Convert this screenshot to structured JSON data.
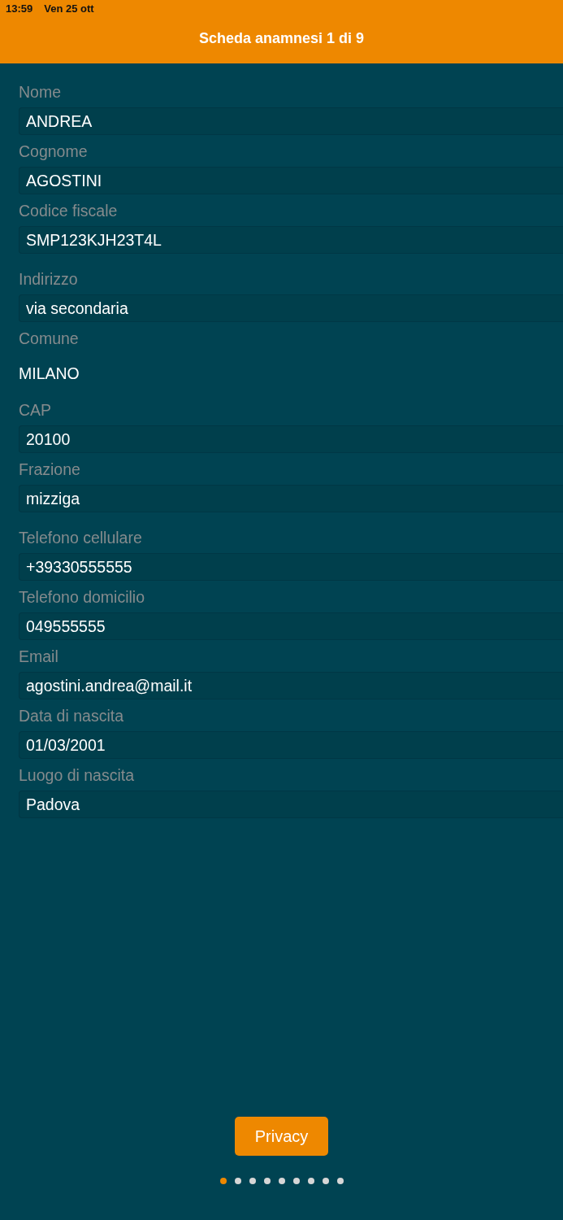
{
  "status_bar": {
    "time": "13:59",
    "date": "Ven 25 ott"
  },
  "header": {
    "title": "Scheda anamnesi 1 di 9"
  },
  "sections": [
    {
      "fields": [
        {
          "label": "Nome",
          "kind": "input",
          "value": "ANDREA"
        },
        {
          "label": "Cognome",
          "kind": "input",
          "value": "AGOSTINI"
        },
        {
          "label": "Codice fiscale",
          "kind": "input",
          "value": "SMP123KJH23T4L"
        }
      ]
    },
    {
      "fields": [
        {
          "label": "Indirizzo",
          "kind": "input",
          "value": "via secondaria"
        },
        {
          "label": "Comune",
          "kind": "text",
          "value": "MILANO"
        },
        {
          "label": "CAP",
          "kind": "input",
          "value": "20100"
        },
        {
          "label": "Frazione",
          "kind": "input",
          "value": "mizziga"
        }
      ]
    },
    {
      "fields": [
        {
          "label": "Telefono cellulare",
          "kind": "input",
          "value": "+39330555555"
        },
        {
          "label": "Telefono domicilio",
          "kind": "input",
          "value": "049555555"
        },
        {
          "label": "Email",
          "kind": "input",
          "value": "agostini.andrea@mail.it"
        },
        {
          "label": "Data di nascita",
          "kind": "input",
          "value": "01/03/2001"
        },
        {
          "label": "Luogo di nascita",
          "kind": "input",
          "value": "Padova"
        }
      ]
    }
  ],
  "privacy_button": {
    "label": "Privacy"
  },
  "pages": [
    {
      "selected": true
    },
    {
      "selected": false
    },
    {
      "selected": false
    },
    {
      "selected": false
    },
    {
      "selected": false
    },
    {
      "selected": false
    },
    {
      "selected": false
    },
    {
      "selected": false
    },
    {
      "selected": false
    }
  ]
}
